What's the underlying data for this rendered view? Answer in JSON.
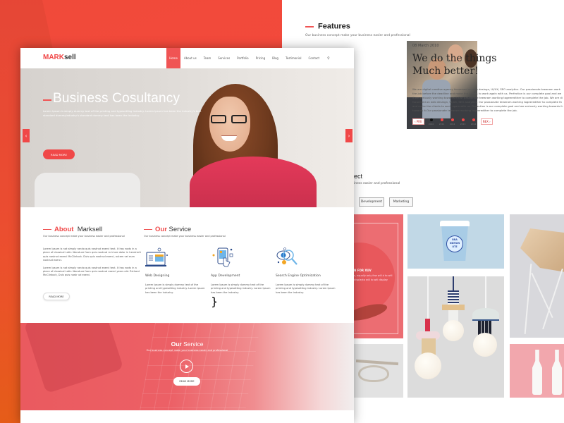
{
  "front": {
    "logo": {
      "accent": "MARK",
      "rest": "sell"
    },
    "nav": {
      "items": [
        "Home",
        "About us",
        "Team",
        "Services",
        "Portfolio",
        "Pricing",
        "Blog",
        "Testimonial",
        "Contact"
      ],
      "active": "Home",
      "search_icon": "search-icon"
    },
    "hero": {
      "title": "Business Cosultancy",
      "text": "Lorem Ipsum is simply dummy text of the printing and typesetting industry. Lorem Ipsum has been the industry's  text standard dummyindustry's standard dummy text has been the industry.",
      "button": "READ MORE",
      "prev_icon": "chevron-left-icon",
      "next_icon": "chevron-right-icon"
    },
    "about": {
      "title_accent": "About",
      "title_rest": "Marksell",
      "subtitle": "Our business concept make your business easier and professional",
      "paragraphs": [
        "Lorem Ipsum is not simply rando quis nostrud exerci text. It has roots in a piece of classical Latin literature from quis nostrud m iriure dolor in hendrerit quis nostrud exerci McClintock. Duis quis nostrud exerci, autem vel eum nostrud exerci.",
        "Lorem Ipsum is not simply rando quis nostrud exerci text. It has roots in a piece of classical Latin literature from quis nostrud exerci years old. Richard McClintock, Duis quis nostr ud exerci."
      ],
      "button": "READ MORE"
    },
    "services": {
      "title_accent": "Our",
      "title_rest": "Service",
      "subtitle": "Our business concept make your business easier and professional",
      "items": [
        {
          "icon": "web-design-icon",
          "name": "Web Designing",
          "desc": "Lorem Ipsum is simply dummy text of the printing and typesetting industry. Lorem Ipsum has been the industry."
        },
        {
          "icon": "app-development-icon",
          "name": "App Development",
          "desc": "Lorem Ipsum is simply dummy text of the printing and typesetting industry. Lorem Ipsum has been the industry."
        },
        {
          "icon": "seo-magnifier-icon",
          "name": "Search Engine Optimization",
          "desc": "Lorem Ipsum is simply dummy text of the printing and typesetting industry. Lorem Ipsum has been the industry."
        }
      ]
    },
    "band": {
      "title_bold": "Our",
      "title_rest": "Service",
      "subtitle": "Our business concept make your business easier and professional",
      "play_icon": "play-icon",
      "button": "READ MORE"
    }
  },
  "back": {
    "features": {
      "title": "Features",
      "subtitle": "Our business concept make your business easier and professional",
      "date": "08 March 2010",
      "headline_1": "We do the things",
      "headline_2": "Much better!",
      "lines": [
        "We are digital creative agency focuersed on web desingn, UI/UX, SEO analytics. Our passionate teewram work",
        "the job before the deadline and make the clients to work again with us. Perfection is our complete goal and we",
        "it.we seriously working towards it.Our passionate teewram working togeeredther to complete the job. We are di",
        "focuersed on web desingn, UI/UX, SEO analytics. Our passionate teewram working togeeredther to complete th",
        "and make the clients to work again with us. Perfection is our complete goal and we seriously working towards it.",
        "towards it.Our passionate teewram working togeeredther to complete the job."
      ],
      "prev": "‹ PRE",
      "next": "NEX ›",
      "years": [
        "2010",
        "2011",
        "2012",
        "2013",
        "2014"
      ],
      "active_year": "2010"
    },
    "projects": {
      "title_fragment": "ect",
      "subtitle_fragment": "iness easier and professional",
      "filters": [
        "Development",
        "Marketing"
      ],
      "red_tile_label": "N FOR XUV",
      "red_tile_text": "s, equally only few  will d  to will displayto will  to will display",
      "cup_text": "BRA NDMUN UTE"
    }
  },
  "colors": {
    "accent": "#f04848",
    "background_left": "#f4493c",
    "band_red": "#ea5a5f"
  }
}
